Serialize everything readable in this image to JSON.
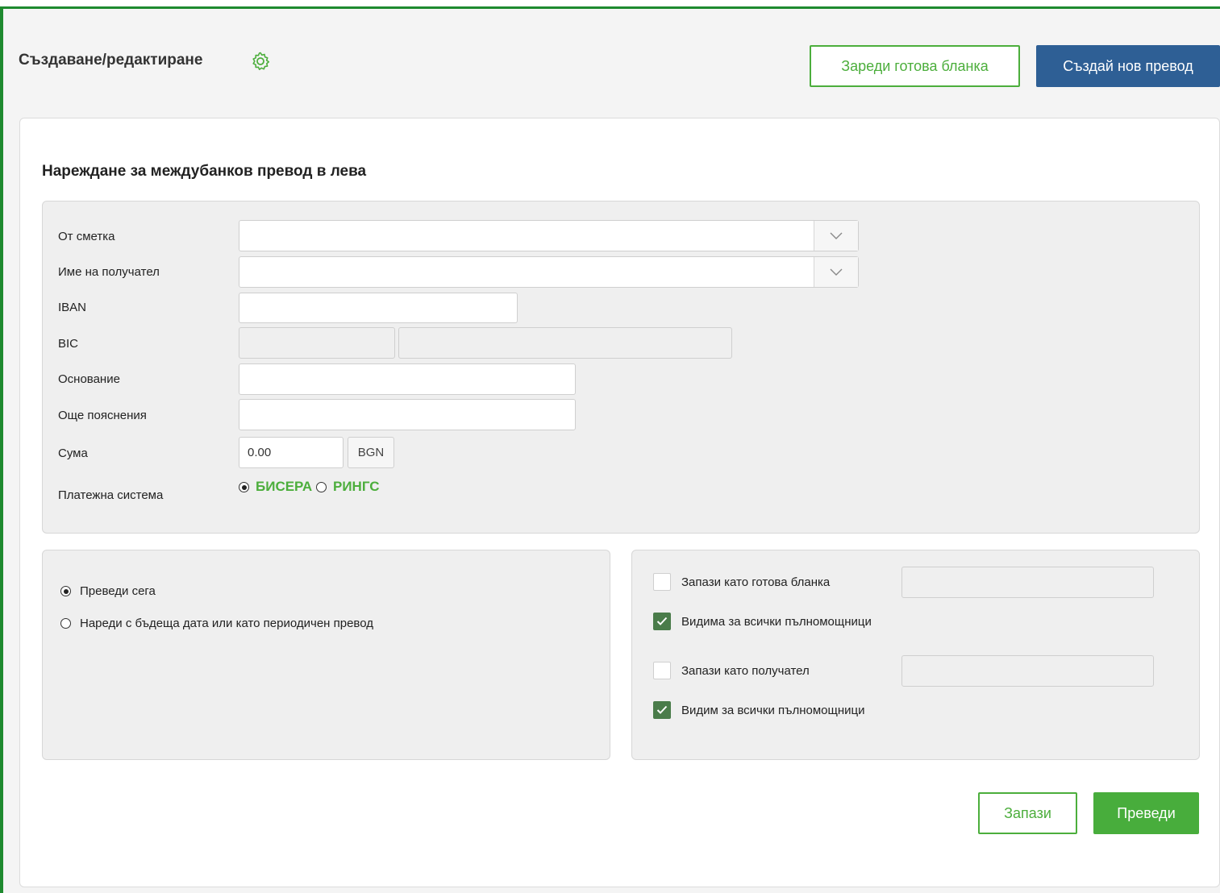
{
  "header": {
    "title": "Създаване/редактиране",
    "load_template_label": "Зареди готова бланка",
    "create_new_label": "Създай нов превод"
  },
  "form": {
    "title": "Нареждане за междубанков превод в лева",
    "fields": {
      "from_account": {
        "label": "От сметка",
        "value": ""
      },
      "recipient_name": {
        "label": "Име на получател",
        "value": ""
      },
      "iban": {
        "label": "IBAN",
        "value": ""
      },
      "bic": {
        "label": "BIC",
        "value": "",
        "bank_name": ""
      },
      "reason": {
        "label": "Основание",
        "value": ""
      },
      "more_details": {
        "label": "Още пояснения",
        "value": ""
      },
      "amount": {
        "label": "Сума",
        "value": "0.00",
        "currency": "BGN"
      },
      "payment_system": {
        "label": "Платежна система",
        "options": [
          "БИСЕРА",
          "РИНГС"
        ],
        "selected": "БИСЕРА"
      }
    }
  },
  "timing": {
    "options": [
      {
        "label": "Преведи сега",
        "selected": true
      },
      {
        "label": "Нареди с бъдеща дата или като периодичен превод",
        "selected": false
      }
    ]
  },
  "save_options": {
    "save_template": {
      "label": "Запази като готова бланка",
      "checked": false,
      "value": ""
    },
    "template_visible": {
      "label": "Видима за всички пълномощници",
      "checked": true
    },
    "save_recipient": {
      "label": "Запази като получател",
      "checked": false,
      "value": ""
    },
    "recipient_visible": {
      "label": "Видим за всички пълномощници",
      "checked": true
    }
  },
  "actions": {
    "save_label": "Запази",
    "transfer_label": "Преведи"
  },
  "colors": {
    "accent_green": "#4cae3c",
    "primary_blue": "#2e5f95",
    "frame_green": "#1e8a2f",
    "checkbox_green": "#4a7c4a"
  }
}
